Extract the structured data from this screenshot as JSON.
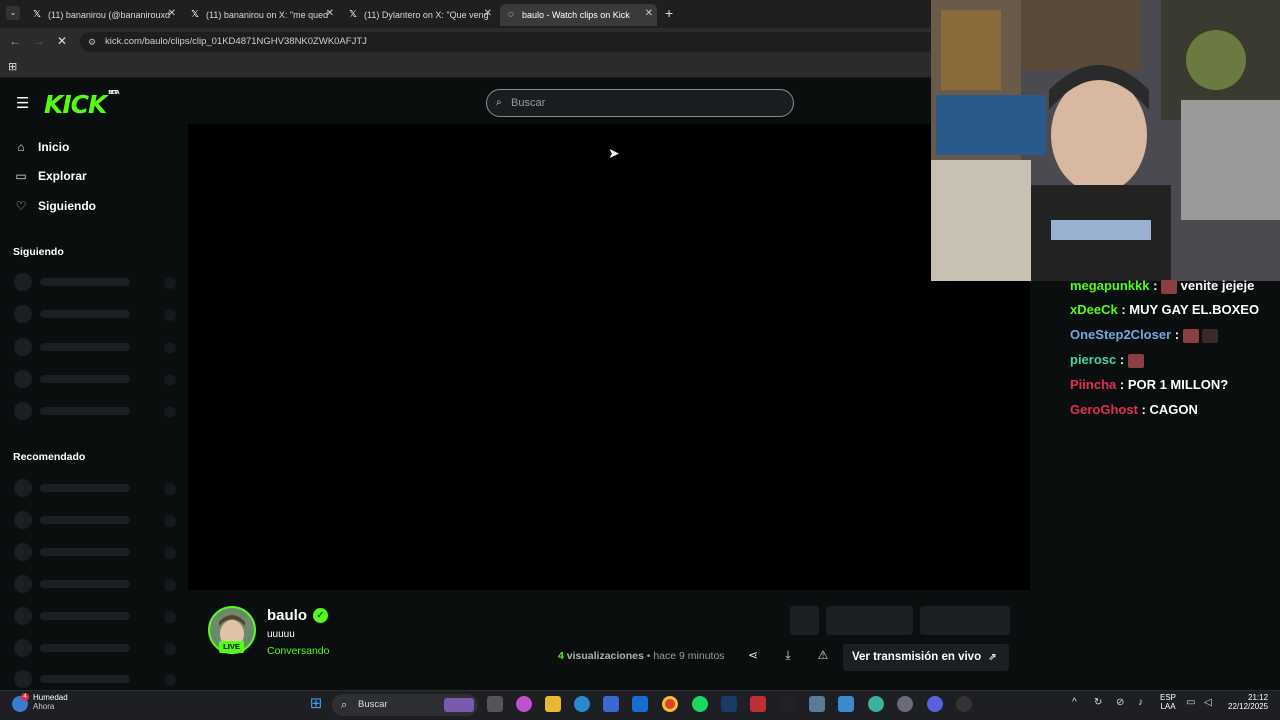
{
  "browser": {
    "tabs": [
      {
        "title": "(11) bananirou (@bananirouxd",
        "icon": "x-logo-icon"
      },
      {
        "title": "(11) bananirou on X: \"me qued",
        "icon": "x-logo-icon"
      },
      {
        "title": "(11) Dylantero on X: \"Que veng",
        "icon": "x-logo-icon"
      },
      {
        "title": "baulo - Watch clips on Kick",
        "icon": "loading-icon"
      }
    ],
    "url": "kick.com/baulo/clips/clip_01KD4871NGHV38NK0ZWK0AFJTJ"
  },
  "kick": {
    "logo": "KICK",
    "logo_badge": "BETA",
    "search_placeholder": "Buscar",
    "nav": [
      {
        "label": "Inicio",
        "icon": "home-icon"
      },
      {
        "label": "Explorar",
        "icon": "explore-icon"
      },
      {
        "label": "Siguiendo",
        "icon": "heart-icon"
      }
    ],
    "section_following": "Siguiendo",
    "section_recommended": "Recomendado",
    "channel": {
      "name": "baulo",
      "live_badge": "LIVE",
      "clip_title": "uuuuu",
      "category": "Conversando",
      "views_count": "4",
      "views_label": "visualizaciones",
      "time_ago": "• hace 9 minutos",
      "watch_live_label": "Ver transmisión en vivo"
    },
    "accent_color": "#53fc18"
  },
  "stream_chat": [
    {
      "user": "megapunkkk",
      "user_color": "#53fc18",
      "msg": "venite jejeje",
      "emote": true
    },
    {
      "user": "xDeeCk",
      "user_color": "#53fc18",
      "msg": "MUY GAY EL.BOXEO",
      "emote": false
    },
    {
      "user": "OneStep2Closer",
      "user_color": "#6fa8dc",
      "msg": "",
      "emote": true
    },
    {
      "user": "pierosc",
      "user_color": "#3fd6a0",
      "msg": "",
      "emote": true
    },
    {
      "user": "Piincha",
      "user_color": "#e03050",
      "msg": "POR 1 MILLON?",
      "emote": false
    },
    {
      "user": "GeroGhost",
      "user_color": "#e03050",
      "msg": "CAGON",
      "emote": false
    }
  ],
  "taskbar": {
    "weather_title": "Humedad",
    "weather_sub": "Ahora",
    "weather_badge": "4",
    "search_label": "Buscar",
    "lang_1": "ESP",
    "lang_2": "LAA",
    "time": "21:12",
    "date": "22/12/2025"
  }
}
